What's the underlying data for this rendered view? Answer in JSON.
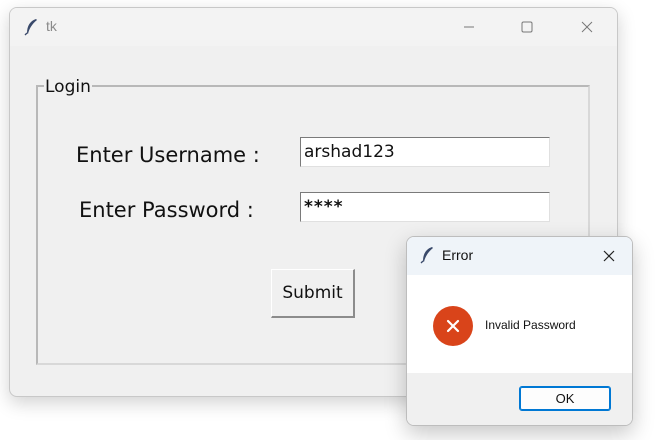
{
  "main_window": {
    "title": "tk",
    "icons": {
      "app": "feather-icon",
      "minimize": "minimize-icon",
      "maximize": "maximize-icon",
      "close": "close-icon"
    },
    "login_frame": {
      "legend": "Login",
      "username_label": "Enter Username :",
      "username_value": "arshad123",
      "password_label": "Enter Password :",
      "password_value": "****",
      "submit_label": "Submit"
    }
  },
  "error_dialog": {
    "title": "Error",
    "icons": {
      "app": "feather-icon",
      "close": "close-icon",
      "error": "error-x-icon"
    },
    "message": "Invalid Password",
    "ok_label": "OK"
  },
  "colors": {
    "window_bg": "#f0f0f0",
    "error_icon": "#d9441a",
    "ok_border": "#0078d4"
  }
}
